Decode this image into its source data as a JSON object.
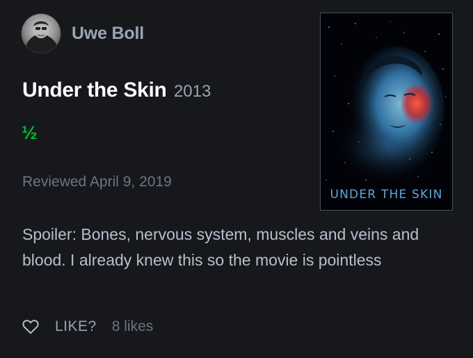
{
  "review": {
    "author": "Uwe Boll",
    "film_title": "Under the Skin",
    "film_year": "2013",
    "rating": "½",
    "reviewed_date": "Reviewed April 9, 2019",
    "body": "Spoiler: Bones, nervous system, muscles and veins and blood. I already knew this so the movie is pointless",
    "poster_title": "UNDER THE SKIN"
  },
  "actions": {
    "like_label": "LIKE?",
    "likes_count": "8 likes",
    "like_icon": "heart-outline-icon"
  },
  "colors": {
    "background": "#16181c",
    "rating_green": "#00c030",
    "muted_text": "#9aa5b3",
    "poster_title_blue": "#5fa8d8"
  }
}
